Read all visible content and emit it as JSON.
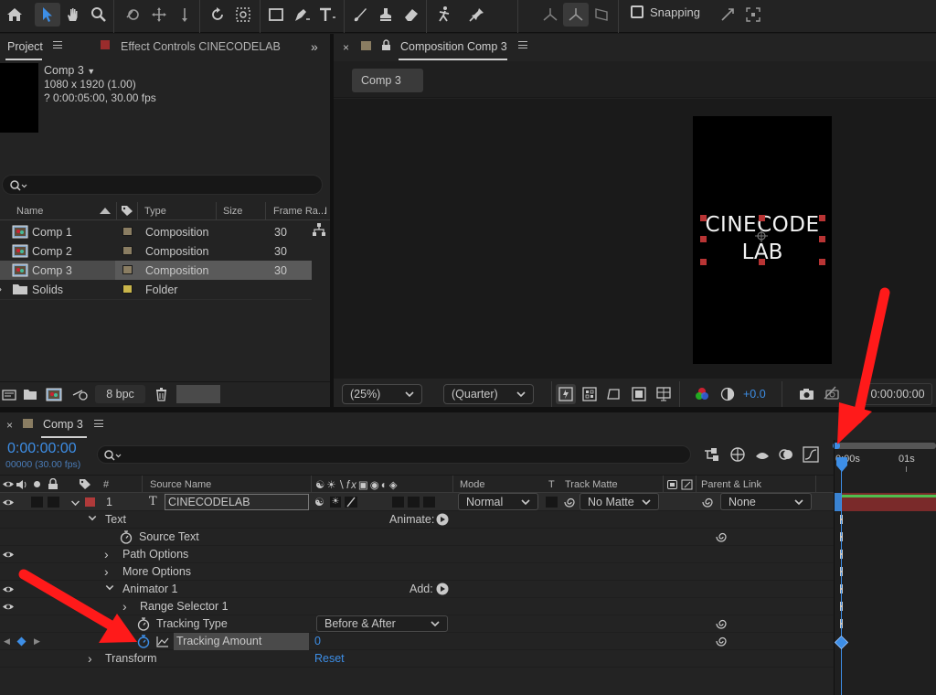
{
  "toolbar": {
    "snapping_label": "Snapping"
  },
  "project_panel": {
    "tab_project": "Project",
    "tab_effect_controls": "Effect Controls CINECODELAB",
    "comp_name": "Comp 3",
    "comp_size": "1080 x 1920 (1.00)",
    "comp_duration": "? 0:00:05:00, 30.00 fps",
    "search_placeholder": "",
    "columns": {
      "name": "Name",
      "type": "Type",
      "size": "Size",
      "frame_rate": "Frame Ra..."
    },
    "rows": [
      {
        "name": "Comp 1",
        "type": "Composition",
        "fps": "30",
        "swatch": "#8a7d62"
      },
      {
        "name": "Comp 2",
        "type": "Composition",
        "fps": "30",
        "swatch": "#8a7d62"
      },
      {
        "name": "Comp 3",
        "type": "Composition",
        "fps": "30",
        "swatch": "#8a7d62"
      },
      {
        "name": "Solids",
        "type": "Folder",
        "fps": "",
        "swatch": "#c9b54a"
      }
    ],
    "bpc_label": "8 bpc"
  },
  "composition_panel": {
    "tab_label": "Composition Comp 3",
    "flow_tab": "Comp 3",
    "canvas_text_line1": "CINECODE",
    "canvas_text_line2": "LAB",
    "zoom_value": "(25%)",
    "resolution_value": "(Quarter)",
    "exposure_value": "+0.0",
    "timecode": "0:00:00:00"
  },
  "timeline": {
    "tab_label": "Comp 3",
    "timecode": "0:00:00:00",
    "frames_fps": "00000 (30.00 fps)",
    "search_placeholder": "",
    "headers": {
      "number": "#",
      "source_name": "Source Name",
      "mode": "Mode",
      "t": "T",
      "track_matte": "Track Matte",
      "parent_link": "Parent & Link"
    },
    "layer": {
      "index": "1",
      "name": "CINECODELAB",
      "mode": "Normal",
      "track_matte": "No Matte",
      "parent": "None"
    },
    "props": {
      "text": "Text",
      "animate": "Animate:",
      "source_text": "Source Text",
      "path_options": "Path Options",
      "more_options": "More Options",
      "animator": "Animator 1",
      "add": "Add:",
      "range_selector": "Range Selector 1",
      "tracking_type": "Tracking Type",
      "tracking_type_value": "Before & After",
      "tracking_amount": "Tracking Amount",
      "tracking_amount_value": "0",
      "transform": "Transform",
      "reset": "Reset"
    },
    "ruler": {
      "tick_0": "0:00s",
      "tick_1": "01s"
    }
  },
  "colors": {
    "accent_blue": "#3d8ee6",
    "layer_label_red": "#b03a3a",
    "annotation_red": "#ff1a1a",
    "layer_bar": "#7a2a2a"
  }
}
